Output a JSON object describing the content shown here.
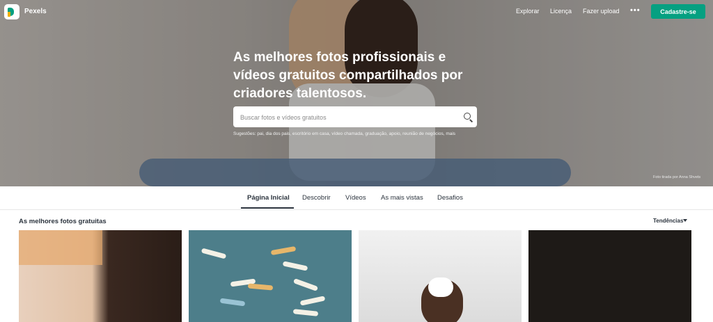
{
  "header": {
    "brand": "Pexels",
    "nav": [
      "Explorar",
      "Licença",
      "Fazer upload"
    ],
    "more": "•••",
    "signup": "Cadastre-se"
  },
  "hero": {
    "headline": "As melhores fotos profissionais e vídeos gratuitos compartilhados por criadores talentosos.",
    "search_placeholder": "Buscar fotos e vídeos gratuitos",
    "suggestions": "Sugestões: pai, dia dos pais, escritório em casa, vídeo chamada, graduação, apoio, reunião de negócios, mais",
    "credit": "Foto tirada por Anna Shvets"
  },
  "tabs": [
    {
      "label": "Página Inicial",
      "active": true
    },
    {
      "label": "Descobrir",
      "active": false
    },
    {
      "label": "Vídeos",
      "active": false
    },
    {
      "label": "As mais vistas",
      "active": false
    },
    {
      "label": "Desafios",
      "active": false
    }
  ],
  "main": {
    "section_title": "As melhores fotos gratuitas",
    "sort": "Tendências"
  },
  "colors": {
    "accent": "#05a081",
    "text_dark": "#2c343e"
  }
}
